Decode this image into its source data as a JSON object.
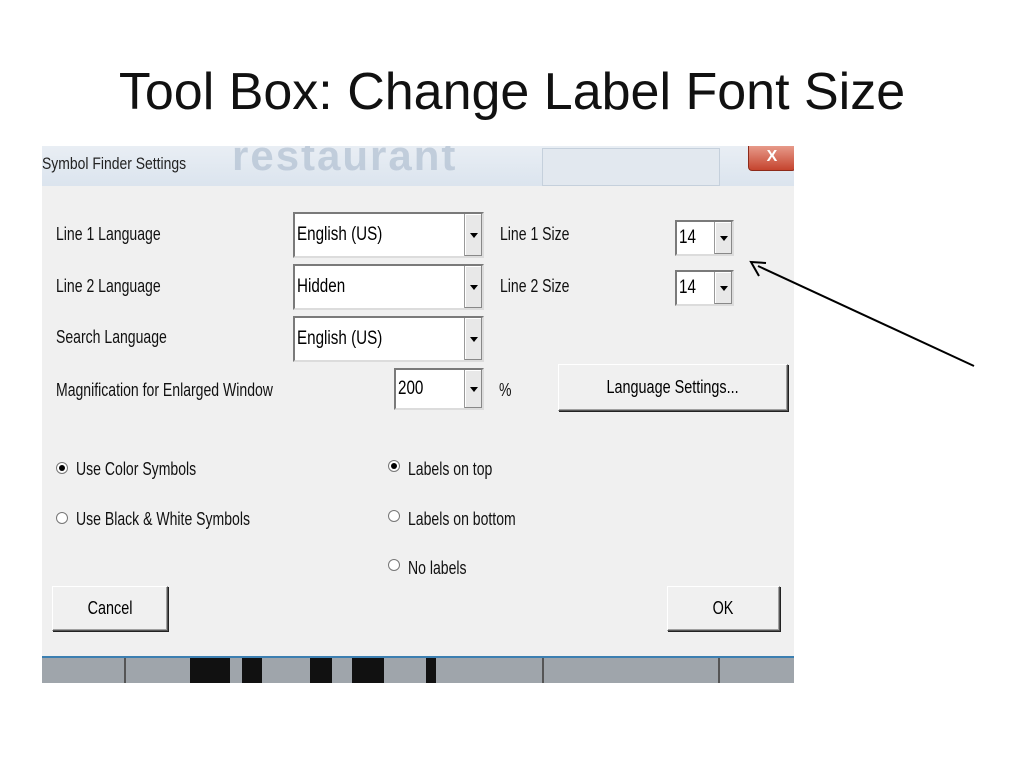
{
  "slide": {
    "title": "Tool Box:  Change Label Font Size"
  },
  "dialog": {
    "title": "Symbol Finder Settings",
    "close_label": "X",
    "background_word": "restaurant",
    "fields": {
      "line1_language": {
        "label": "Line 1 Language",
        "value": "English (US)"
      },
      "line2_language": {
        "label": "Line 2 Language",
        "value": "Hidden"
      },
      "search_language": {
        "label": "Search Language",
        "value": "English (US)"
      },
      "magnification": {
        "label": "Magnification for Enlarged Window",
        "value": "200",
        "unit": "%"
      },
      "line1_size": {
        "label": "Line 1 Size",
        "value": "14"
      },
      "line2_size": {
        "label": "Line 2 Size",
        "value": "14"
      }
    },
    "language_settings_button": "Language Settings...",
    "symbol_options": [
      {
        "label": "Use Color Symbols",
        "selected": true
      },
      {
        "label": "Use Black & White Symbols",
        "selected": false
      }
    ],
    "label_options": [
      {
        "label": "Labels on top",
        "selected": true
      },
      {
        "label": "Labels on bottom",
        "selected": false
      },
      {
        "label": "No labels",
        "selected": false
      }
    ],
    "cancel_button": "Cancel",
    "ok_button": "OK"
  },
  "colors": {
    "dialog_bg": "#f0f0f0",
    "close_button": "#c5442e",
    "accent_line": "#3c7fb1"
  }
}
